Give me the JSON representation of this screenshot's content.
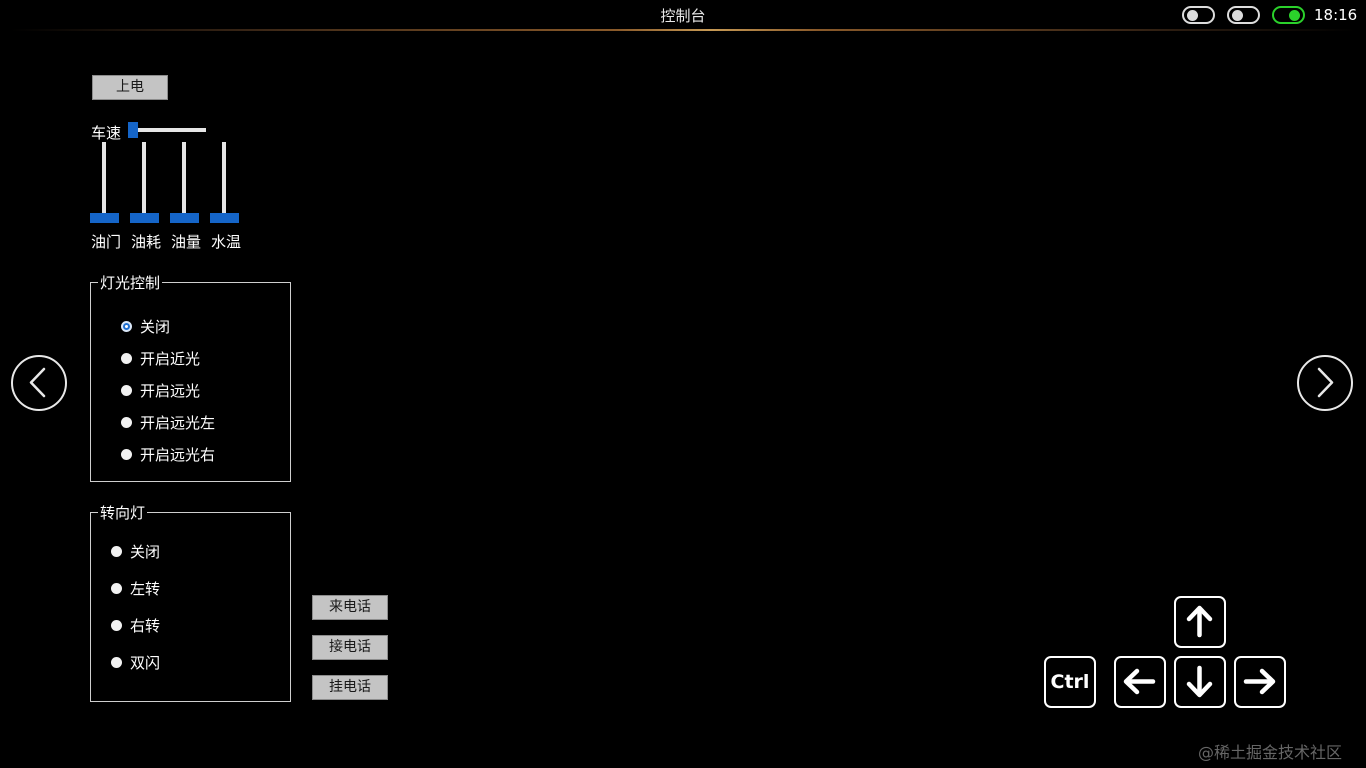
{
  "header": {
    "title": "控制台",
    "clock": "18:16",
    "toggles": [
      {
        "name": "toggle-1",
        "state": "off"
      },
      {
        "name": "toggle-2",
        "state": "off"
      },
      {
        "name": "toggle-3",
        "state": "on"
      }
    ]
  },
  "power": {
    "label": "上电"
  },
  "speed": {
    "label": "车速",
    "value": 0
  },
  "gauges": [
    {
      "label": "油门",
      "value": 0
    },
    {
      "label": "油耗",
      "value": 0
    },
    {
      "label": "油量",
      "value": 0
    },
    {
      "label": "水温",
      "value": 0
    }
  ],
  "lights": {
    "title": "灯光控制",
    "options": [
      "关闭",
      "开启近光",
      "开启远光",
      "开启远光左",
      "开启远光右"
    ],
    "selected": "关闭"
  },
  "turn_signal": {
    "title": "转向灯",
    "options": [
      "关闭",
      "左转",
      "右转",
      "双闪"
    ],
    "selected": null
  },
  "phone": {
    "incoming_label": "来电话",
    "answer_label": "接电话",
    "hangup_label": "挂电话"
  },
  "keys": {
    "ctrl_label": "Ctrl"
  },
  "icons": {
    "prev": "chevron-left-icon",
    "next": "chevron-right-icon",
    "up": "arrow-up-icon",
    "down": "arrow-down-icon",
    "left": "arrow-left-icon",
    "right": "arrow-right-icon"
  },
  "colors": {
    "accent": "#1565c8",
    "toggle_on": "#2bd12b",
    "button_bg": "#c4c4c4"
  },
  "watermark": "@稀土掘金技术社区"
}
